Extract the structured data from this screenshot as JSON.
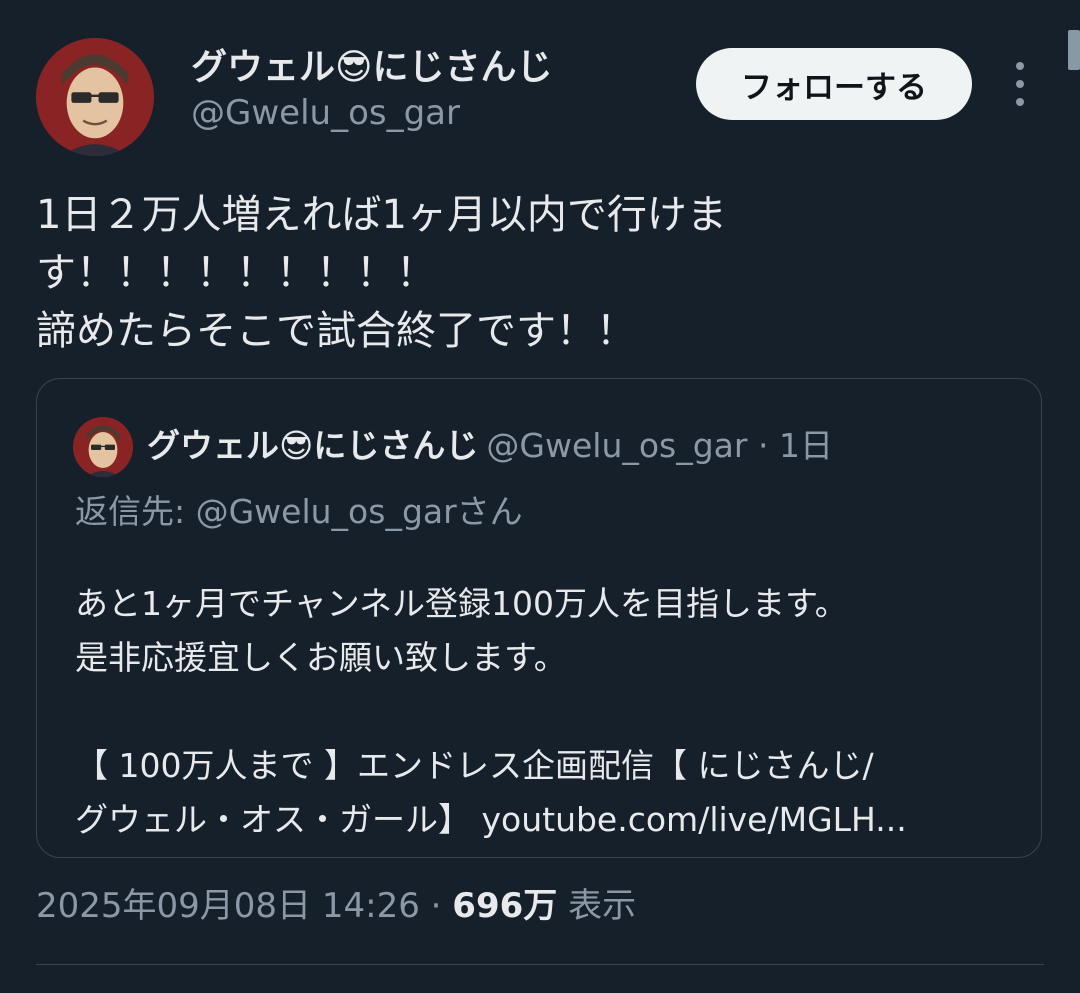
{
  "author": {
    "display_name": "グウェル😎にじさんじ",
    "handle": "@Gwelu_os_gar"
  },
  "follow_label": "フォローする",
  "tweet": {
    "lines": [
      "1日２万人増えれば1ヶ月以内で行けま",
      "す！！！！！！！！！",
      "諦めたらそこで試合終了です！！"
    ]
  },
  "quote": {
    "display_name": "グウェル😎にじさんじ",
    "meta": "@Gwelu_os_gar · 1日",
    "reply_to": "返信先: @Gwelu_os_garさん",
    "body_lines": [
      "あと1ヶ月でチャンネル登録100万人を目指します。",
      "是非応援宜しくお願い致します。",
      "",
      "【 100万人まで 】エンドレス企画配信【 にじさんじ/",
      "グウェル・オス・ガール】 youtube.com/live/MGLH..."
    ]
  },
  "meta": {
    "timestamp": "2025年09月08日 14:26 ·",
    "views": "696万",
    "views_label": "表示"
  },
  "icons": [
    "avatar-image",
    "more-options-icon"
  ],
  "colors": {
    "background": "#15202b",
    "text": "#e7e9ea",
    "secondary_text": "#8b98a5",
    "border": "#38444d",
    "follow_button": "#eff3f4"
  }
}
